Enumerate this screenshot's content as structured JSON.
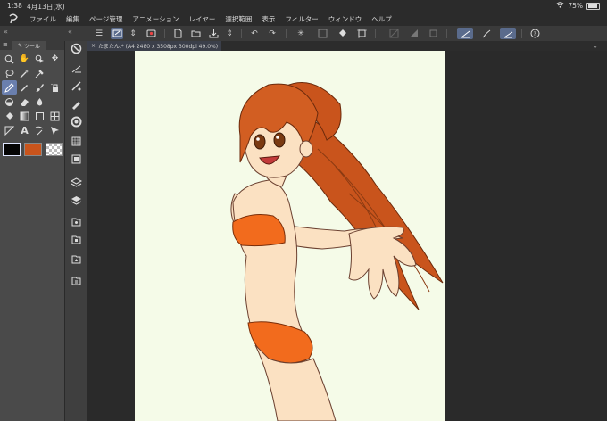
{
  "status": {
    "time": "1:38",
    "date": "4月13日(水)",
    "battery": "75%"
  },
  "menu": {
    "items": [
      "ファイル",
      "編集",
      "ページ管理",
      "アニメーション",
      "レイヤー",
      "選択範囲",
      "表示",
      "フィルター",
      "ウィンドウ",
      "ヘルプ"
    ]
  },
  "tool_panel": {
    "tab_label": "ツール"
  },
  "document": {
    "tab_title": "たまたん.* (A4 2480 x 3508px 300dpi 49.0%)"
  },
  "colors": {
    "main": "#050505",
    "sub": "#c9541c",
    "accent": "#5a6b8c",
    "paper": "#f5fbe8"
  },
  "illustration": {
    "subject": "anime girl with long orange hair in orange bikini reaching toward viewer"
  }
}
